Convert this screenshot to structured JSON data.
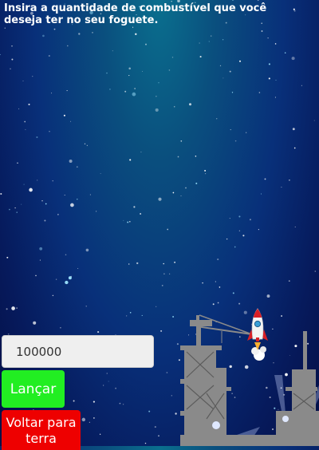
{
  "instruction": "Insira a quantidade de combustível que você deseja ter no seu foguete.",
  "fuel_input": {
    "value": "100000"
  },
  "buttons": {
    "launch_label": "Lançar",
    "back_label": "Voltar para terra"
  },
  "colors": {
    "launch_button": "#22ee22",
    "back_button": "#ee0000",
    "tower": "#8a8a8a",
    "rocket_fin": "#d81f26"
  }
}
